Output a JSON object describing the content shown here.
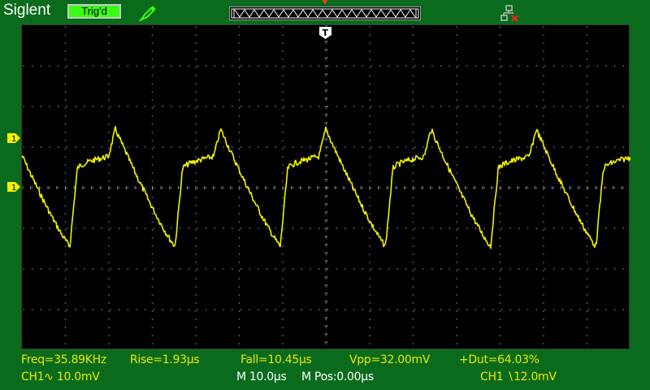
{
  "header": {
    "brand": "Siglent",
    "trigger_status": "Trig'd"
  },
  "icons": {
    "probe": "probe-pen-icon",
    "network": "network-disconnected-icon",
    "trigger_position": "trigger-position-marker-icon",
    "channel_level": "ch1-level-marker-icon",
    "channel_ground": "ch1-ground-marker-icon",
    "trigger_t": "trigger-t-icon"
  },
  "markers": {
    "ch1_level_label": "1",
    "ch1_ground_label": "1",
    "trigger_label": "T"
  },
  "measurements": {
    "freq": "Freq=35.89KHz",
    "rise": "Rise=1.93μs",
    "fall": "Fall=10.45μs",
    "vpp": "Vpp=32.00mV",
    "duty": "+Dut=64.03%"
  },
  "status_bar": {
    "ch1_scale": "CH1∿ 10.0mV",
    "timebase": "M 10.0μs",
    "mpos": "M Pos:0.00μs",
    "trigger": "CH1 ∖12.0mV"
  },
  "colors": {
    "background": "#0a6b1c",
    "screen": "#000000",
    "trace": "#f2f200",
    "measure_text": "#e8e800",
    "trig_badge": "#39ff14"
  },
  "waveform": {
    "type": "sawtooth-like",
    "frequency_khz": 35.89,
    "vpp_mv": 32.0,
    "duty_percent": 64.03
  }
}
